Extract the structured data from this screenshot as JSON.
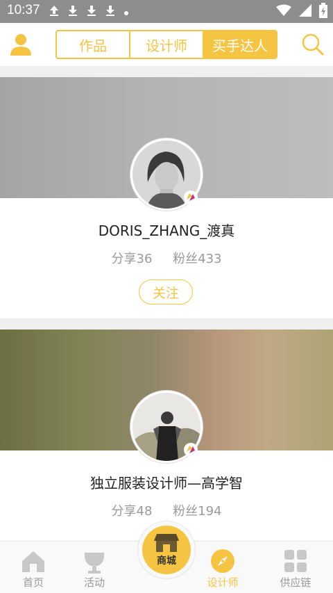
{
  "status_bar": {
    "time": "10:37",
    "left_icons": [
      "upload-icon",
      "download-icon",
      "download-icon",
      "download-icon",
      "dot-icon"
    ],
    "right_icons": [
      "wifi-icon",
      "signal-icon",
      "battery-icon"
    ]
  },
  "header": {
    "tabs": [
      {
        "label": "作品",
        "active": false
      },
      {
        "label": "设计师",
        "active": false
      },
      {
        "label": "买手达人",
        "active": true
      }
    ]
  },
  "cards": [
    {
      "name": "DORIS_ZHANG_渡真",
      "shares": "分享36",
      "fans": "粉丝433",
      "follow_label": "关注"
    },
    {
      "name": "独立服装设计师—高学智",
      "shares": "分享48",
      "fans": "粉丝194"
    }
  ],
  "bottom_nav": {
    "items": [
      {
        "label": "首页",
        "icon": "home-icon",
        "active": false
      },
      {
        "label": "活动",
        "icon": "trophy-icon",
        "active": false
      },
      {
        "label": "设计师",
        "icon": "compass-icon",
        "active": true
      },
      {
        "label": "供应链",
        "icon": "grid-icon",
        "active": false
      }
    ],
    "center_label": "商城"
  },
  "colors": {
    "accent": "#f6c443",
    "status_bar": "#8d8d8d"
  }
}
